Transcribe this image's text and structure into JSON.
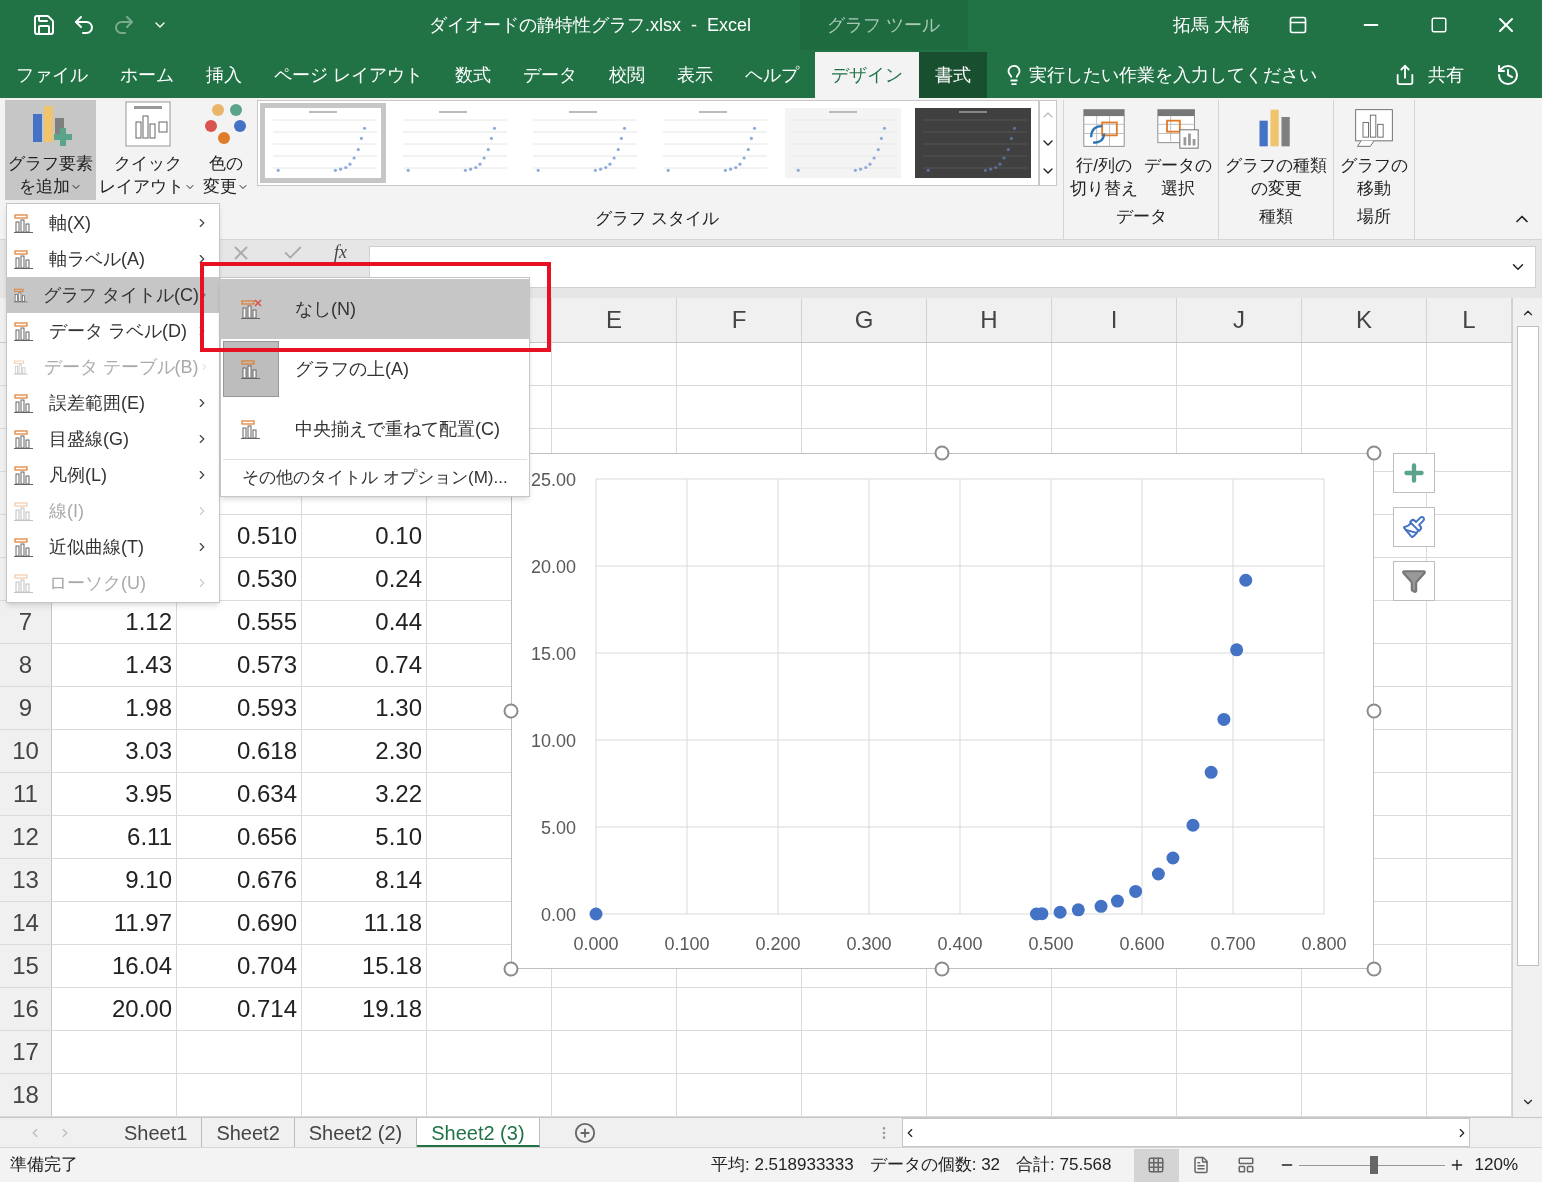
{
  "window": {
    "title": "ダイオードの静特性グラフ.xlsx  -  Excel",
    "context_tab": "グラフ ツール",
    "user": "拓馬 大橋",
    "redo_disabled": true
  },
  "tabs": [
    {
      "label": "ファイル",
      "selected": false,
      "context": false
    },
    {
      "label": "ホーム",
      "selected": false,
      "context": false
    },
    {
      "label": "挿入",
      "selected": false,
      "context": false
    },
    {
      "label": "ページ レイアウト",
      "selected": false,
      "context": false
    },
    {
      "label": "数式",
      "selected": false,
      "context": false
    },
    {
      "label": "データ",
      "selected": false,
      "context": false
    },
    {
      "label": "校閲",
      "selected": false,
      "context": false
    },
    {
      "label": "表示",
      "selected": false,
      "context": false
    },
    {
      "label": "ヘルプ",
      "selected": false,
      "context": false
    },
    {
      "label": "デザイン",
      "selected": true,
      "context": true
    },
    {
      "label": "書式",
      "selected": false,
      "context": true
    }
  ],
  "tell_me": "実行したい作業を入力してください",
  "share": "共有",
  "ribbon": {
    "left_buttons": [
      {
        "kind": "add",
        "lines": [
          "グラフ要素",
          "を追加"
        ],
        "dropdown": true,
        "selected": true
      },
      {
        "kind": "layout",
        "lines": [
          "クイック",
          "レイアウト"
        ],
        "dropdown": true,
        "selected": false
      },
      {
        "kind": "colors",
        "lines": [
          "色の",
          "変更"
        ],
        "dropdown": true,
        "selected": false
      }
    ],
    "gallery": [
      {
        "kind": "light",
        "selected": true
      },
      {
        "kind": "light",
        "selected": false
      },
      {
        "kind": "light",
        "selected": false
      },
      {
        "kind": "light",
        "selected": false
      },
      {
        "kind": "grid",
        "selected": false
      },
      {
        "kind": "dark",
        "selected": false
      }
    ],
    "gallery_label": "グラフ スタイル",
    "groups": [
      {
        "label": "データ",
        "buttons": [
          {
            "kind": "switch",
            "lines": [
              "行/列の",
              "切り替え"
            ]
          },
          {
            "kind": "select",
            "lines": [
              "データの",
              "選択"
            ]
          }
        ]
      },
      {
        "label": "種類",
        "buttons": [
          {
            "kind": "type",
            "lines": [
              "グラフの種類",
              "の変更"
            ]
          }
        ]
      },
      {
        "label": "場所",
        "buttons": [
          {
            "kind": "move",
            "lines": [
              "グラフの",
              "移動"
            ]
          }
        ]
      }
    ]
  },
  "formula_bar": {
    "fx": "fx"
  },
  "columns": [
    "E",
    "F",
    "G",
    "H",
    "I",
    "J",
    "K",
    "L"
  ],
  "rows": [
    {},
    {},
    {},
    {},
    {
      "b": "0.510",
      "c": "0.10"
    },
    {
      "b": "0.530",
      "c": "0.24"
    },
    {
      "number": "7",
      "a": "1.12",
      "b": "0.555",
      "c": "0.44"
    },
    {
      "number": "8",
      "a": "1.43",
      "b": "0.573",
      "c": "0.74"
    },
    {
      "number": "9",
      "a": "1.98",
      "b": "0.593",
      "c": "1.30"
    },
    {
      "number": "10",
      "a": "3.03",
      "b": "0.618",
      "c": "2.30"
    },
    {
      "number": "11",
      "a": "3.95",
      "b": "0.634",
      "c": "3.22"
    },
    {
      "number": "12",
      "a": "6.11",
      "b": "0.656",
      "c": "5.10"
    },
    {
      "number": "13",
      "a": "9.10",
      "b": "0.676",
      "c": "8.14"
    },
    {
      "number": "14",
      "a": "11.97",
      "b": "0.690",
      "c": "11.18"
    },
    {
      "number": "15",
      "a": "16.04",
      "b": "0.704",
      "c": "15.18"
    },
    {
      "number": "16",
      "a": "20.00",
      "b": "0.714",
      "c": "19.18"
    },
    {
      "number": "17"
    },
    {
      "number": "18"
    }
  ],
  "chart": {
    "chart_data": {
      "type": "scatter",
      "x": [
        0,
        0.484,
        0.49,
        0.51,
        0.53,
        0.555,
        0.573,
        0.593,
        0.618,
        0.634,
        0.656,
        0.676,
        0.69,
        0.704,
        0.714
      ],
      "grid": true,
      "series": [
        {
          "color": "#4472c4",
          "values": [
            0,
            0,
            0.02,
            0.1,
            0.24,
            0.44,
            0.74,
            1.3,
            2.3,
            3.22,
            5.1,
            8.14,
            11.18,
            15.18,
            19.18
          ]
        }
      ],
      "xlim": [
        0,
        0.8
      ],
      "ylim": [
        0,
        25
      ],
      "xticks": [
        {
          "value": 0,
          "label": "0.000"
        },
        {
          "value": 0.1,
          "label": "0.100"
        },
        {
          "value": 0.2,
          "label": "0.200"
        },
        {
          "value": 0.3,
          "label": "0.300"
        },
        {
          "value": 0.4,
          "label": "0.400"
        },
        {
          "value": 0.5,
          "label": "0.500"
        },
        {
          "value": 0.6,
          "label": "0.600"
        },
        {
          "value": 0.7,
          "label": "0.700"
        },
        {
          "value": 0.8,
          "label": "0.800"
        }
      ],
      "yticks": [
        {
          "value": 0,
          "label": "0.00"
        },
        {
          "value": 5,
          "label": "5.00"
        },
        {
          "value": 10,
          "label": "10.00"
        },
        {
          "value": 15,
          "label": "15.00"
        },
        {
          "value": 20,
          "label": "20.00"
        },
        {
          "value": 25,
          "label": "25.00"
        }
      ]
    }
  },
  "menu": [
    {
      "label": "軸(X)",
      "disabled": false,
      "selected": false
    },
    {
      "label": "軸ラベル(A)",
      "disabled": false,
      "selected": false
    },
    {
      "label": "グラフ タイトル(C)",
      "disabled": false,
      "selected": true
    },
    {
      "label": "データ ラベル(D)",
      "disabled": false,
      "selected": false
    },
    {
      "label": "データ テーブル(B)",
      "disabled": true,
      "selected": false
    },
    {
      "label": "誤差範囲(E)",
      "disabled": false,
      "selected": false
    },
    {
      "label": "目盛線(G)",
      "disabled": false,
      "selected": false
    },
    {
      "label": "凡例(L)",
      "disabled": false,
      "selected": false
    },
    {
      "label": "線(I)",
      "disabled": true,
      "selected": false
    },
    {
      "label": "近似曲線(T)",
      "disabled": false,
      "selected": false
    },
    {
      "label": "ローソク(U)",
      "disabled": true,
      "selected": false
    }
  ],
  "submenu": {
    "items": [
      {
        "label": "なし(N)",
        "selected": true,
        "current": false,
        "kind": "none"
      },
      {
        "label": "グラフの上(A)",
        "selected": false,
        "current": true,
        "kind": "above"
      },
      {
        "label": "中央揃えで重ねて配置(C)",
        "selected": false,
        "current": false,
        "kind": "overlay"
      }
    ],
    "more": "その他のタイトル オプション(M)..."
  },
  "sheets": [
    {
      "label": "Sheet1",
      "selected": false
    },
    {
      "label": "Sheet2",
      "selected": false
    },
    {
      "label": "Sheet2 (2)",
      "selected": false
    },
    {
      "label": "Sheet2 (3)",
      "selected": true
    }
  ],
  "status_bar": {
    "ready": "準備完了",
    "average": "平均: 2.518933333",
    "count": "データの個数: 32",
    "sum": "合計: 75.568",
    "views": [
      {
        "kind": "normal",
        "selected": true
      },
      {
        "kind": "page",
        "selected": false
      },
      {
        "kind": "break",
        "selected": false
      }
    ],
    "zoom": {
      "level": 0.52,
      "reading": "120%"
    }
  }
}
